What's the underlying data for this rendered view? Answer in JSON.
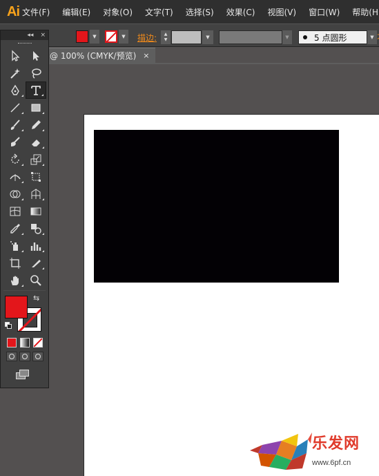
{
  "app": {
    "logo": "Ai"
  },
  "menu": [
    "文件(F)",
    "编辑(E)",
    "对象(O)",
    "文字(T)",
    "选择(S)",
    "效果(C)",
    "视图(V)",
    "窗口(W)",
    "帮助(H)"
  ],
  "control_bar": {
    "fill_color": "#e3161b",
    "stroke_color": "none",
    "stroke_label": "描边:",
    "brush_label": "5 点圆形",
    "cut_text": "不"
  },
  "document_tab": {
    "title": "@ 100% (CMYK/预览)",
    "close": "×"
  },
  "tools_panel": {
    "header_collapse": "◂◂",
    "header_close": "×",
    "tools": [
      {
        "name": "selection-tool-icon"
      },
      {
        "name": "direct-selection-tool-icon"
      },
      {
        "name": "magic-wand-tool-icon"
      },
      {
        "name": "lasso-tool-icon"
      },
      {
        "name": "pen-tool-icon"
      },
      {
        "name": "type-tool-icon"
      },
      {
        "name": "line-segment-tool-icon"
      },
      {
        "name": "rectangle-tool-icon"
      },
      {
        "name": "paintbrush-tool-icon"
      },
      {
        "name": "pencil-tool-icon"
      },
      {
        "name": "blob-brush-tool-icon"
      },
      {
        "name": "eraser-tool-icon"
      },
      {
        "name": "rotate-tool-icon"
      },
      {
        "name": "scale-tool-icon"
      },
      {
        "name": "width-tool-icon"
      },
      {
        "name": "free-transform-tool-icon"
      },
      {
        "name": "shape-builder-tool-icon"
      },
      {
        "name": "perspective-grid-tool-icon"
      },
      {
        "name": "mesh-tool-icon"
      },
      {
        "name": "gradient-tool-icon"
      },
      {
        "name": "eyedropper-tool-icon"
      },
      {
        "name": "blend-tool-icon"
      },
      {
        "name": "symbol-sprayer-tool-icon"
      },
      {
        "name": "column-graph-tool-icon"
      },
      {
        "name": "artboard-tool-icon"
      },
      {
        "name": "slice-tool-icon"
      },
      {
        "name": "hand-tool-icon"
      },
      {
        "name": "zoom-tool-icon"
      }
    ],
    "active_tool": "type-tool-icon",
    "fill": "#e3161b",
    "stroke": "none",
    "swap_glyph": "⇆"
  },
  "canvas": {
    "artboard_color": "#ffffff",
    "rectangle_color": "#030105"
  },
  "watermark": {
    "brand": "乐发网",
    "url": "www.6pf.cn"
  }
}
